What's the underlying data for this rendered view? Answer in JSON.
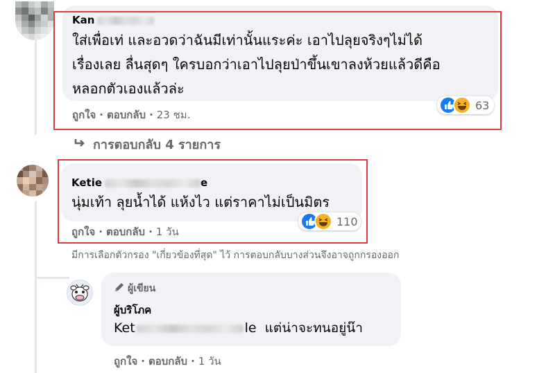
{
  "comments": [
    {
      "author": "Kan",
      "author_tail": "N  D l",
      "lines": [
        "ใส่เพื่อเท่ และอวดว่าฉันมีเท่านั้นแระค่ะ เอาไปลุยจริงๆไม่ได้",
        "เรื่องเลย ลื่นสุดๆ ใครบอกว่าเอาไปลุยป่าขึ้นเขาลงห้วยแล้วดีคือ",
        "หลอกตัวเองแล้วล่ะ"
      ],
      "like_label": "ถูกใจ",
      "reply_label": "ตอบกลับ",
      "time": "23 ชม.",
      "reaction_count": "63"
    },
    {
      "author": "Ketie",
      "author_tail": "e",
      "lines": [
        "นุ่มเท้า ลุยน้ำได้ แห้งไว แต่ราคาไม่เป็นมิตร"
      ],
      "like_label": "ถูกใจ",
      "reply_label": "ตอบกลับ",
      "time": "1 วัน",
      "reaction_count": "110"
    }
  ],
  "replies_link": "การตอบกลับ 4 รายการ",
  "filter_note": "มีการเลือกตัวกรอง \"เกี่ยวข้องที่สุด\" ไว้ การตอบกลับบางส่วนจึงอาจถูกกรองออก",
  "reply": {
    "badge": "ผู้เขียน",
    "author": "ผู้บริโภค",
    "mention_start": "Ket",
    "mention_end": "le",
    "text": "แต่น่าจะทนอยู่น๊า",
    "like_label": "ถูกใจ",
    "reply_label": "ตอบกลับ",
    "time": "1 วัน"
  },
  "colors": {
    "highlight": "#e0393e",
    "bubble": "#f0f2f5",
    "secondary_text": "#65676b",
    "like_blue": "#1877f2",
    "haha_yellow": "#f7b125"
  },
  "icons": [
    "like-reaction-icon",
    "haha-reaction-icon",
    "reply-arrow-icon",
    "pencil-icon"
  ]
}
